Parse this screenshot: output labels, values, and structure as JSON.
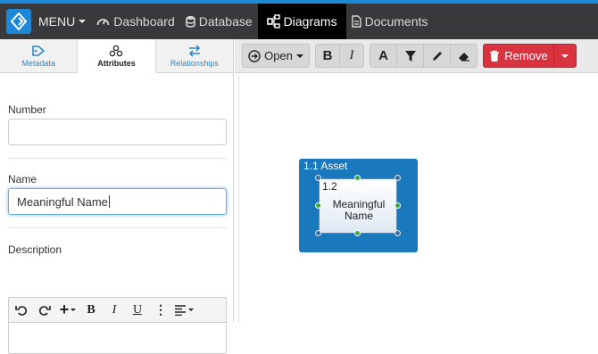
{
  "navbar": {
    "menu_label": "MENU",
    "items": [
      {
        "label": "Dashboard"
      },
      {
        "label": "Database"
      },
      {
        "label": "Diagrams"
      },
      {
        "label": "Documents"
      }
    ]
  },
  "left_panel": {
    "tabs": [
      {
        "label": "Metadata"
      },
      {
        "label": "Attributes"
      },
      {
        "label": "Relationships"
      }
    ],
    "fields": {
      "number": {
        "label": "Number",
        "value": ""
      },
      "name": {
        "label": "Name",
        "value": "Meaningful Name"
      },
      "description": {
        "label": "Description"
      }
    },
    "rte": {
      "bold": "B",
      "italic": "I",
      "underline": "U",
      "more": "⋮",
      "insert": "+"
    }
  },
  "diagram_toolbar": {
    "open_label": "Open",
    "bold": "B",
    "italic": "I",
    "text": "A",
    "remove_label": "Remove"
  },
  "diagram": {
    "asset_label": "1.1 Asset",
    "inner_id": "1.2",
    "inner_name": "Meaningful Name"
  },
  "colors": {
    "accent": "#1e88d8",
    "navbar": "#37393b",
    "remove": "#d9333f",
    "asset_fill": "#1a78bd"
  }
}
